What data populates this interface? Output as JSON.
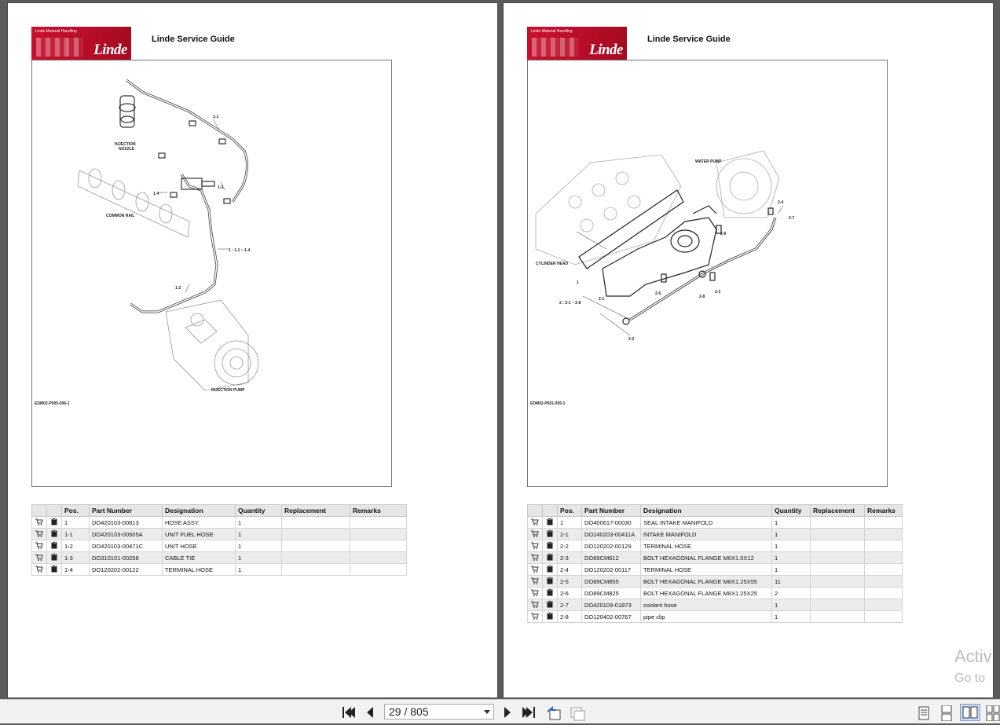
{
  "viewer": {
    "current_page": "29",
    "page_separator": "/",
    "total_pages": "805"
  },
  "watermark": {
    "line1": "Activ",
    "line2": "Go to"
  },
  "left_page": {
    "logo_small": "Linde Material Handling",
    "logo_brand": "Linde",
    "title": "Linde Service Guide",
    "drawing_code": "EDM02-P505-006-1",
    "labels": {
      "injection_nozzle_1": "INJECTION",
      "injection_nozzle_2": "NOZZLE",
      "common_rail": "COMMON RAIL",
      "injection_pump": "INJECTION PUMP",
      "c11": "1-1",
      "c12": "1-2",
      "c13": "1-3",
      "c14": "1-4",
      "range": "1 : 1-1 ~ 1-4"
    },
    "columns": [
      "Pos.",
      "Part Number",
      "Designation",
      "Quantity",
      "Replacement",
      "Remarks"
    ],
    "rows": [
      {
        "pos": "1",
        "part": "DO420103-00813",
        "designation": "HOSE ASSY.",
        "qty": "1"
      },
      {
        "pos": "1-1",
        "part": "DO420103-00505A",
        "designation": "UNIT FUEL HOSE",
        "qty": "1"
      },
      {
        "pos": "1-2",
        "part": "DO420103-00471C",
        "designation": "UNIT HOSE",
        "qty": "1"
      },
      {
        "pos": "1-3",
        "part": "DO310101-00258",
        "designation": "CABLE TIE",
        "qty": "1"
      },
      {
        "pos": "1-4",
        "part": "DO120202-00122",
        "designation": "TERMINAL HOSE",
        "qty": "1"
      }
    ]
  },
  "right_page": {
    "logo_small": "Linde Material Handling",
    "logo_brand": "Linde",
    "title": "Linde Service Guide",
    "drawing_code": "EDM02-P601-005-1",
    "labels": {
      "water_pump": "WATER PUMP",
      "cylinder_head": "CYLINDER HEAD",
      "c1": "1",
      "c21": "2-1",
      "c22": "2-2",
      "c23": "2-3",
      "c24": "2-4",
      "c25": "2-5",
      "c26": "2-6",
      "c27": "2-7",
      "c28": "2-8",
      "range": "2 : 2-1 ~ 2-8"
    },
    "columns": [
      "Pos.",
      "Part Number",
      "Designation",
      "Quantity",
      "Replacement",
      "Remarks"
    ],
    "rows": [
      {
        "pos": "1",
        "part": "DO400617-00030",
        "designation": "SEAL INTAKE MANIFOLD",
        "qty": "1"
      },
      {
        "pos": "2-1",
        "part": "DO240203-00411A",
        "designation": "INTAKE MANIFOLD",
        "qty": "1"
      },
      {
        "pos": "2-2",
        "part": "DO120202-00129",
        "designation": "TERMINAL HOSE",
        "qty": "1"
      },
      {
        "pos": "2-3",
        "part": "DO89CM612",
        "designation": "BOLT HEXAGONAL FLANGE M6X1.0X12",
        "qty": "1"
      },
      {
        "pos": "2-4",
        "part": "DO120202-00117",
        "designation": "TERMINAL HOSE",
        "qty": "1"
      },
      {
        "pos": "2-5",
        "part": "DO89CM855",
        "designation": "BOLT HEXAGONAL FLANGE M8X1.25X55",
        "qty": "11"
      },
      {
        "pos": "2-6",
        "part": "DO89CM825",
        "designation": "BOLT HEXAGONAL FLANGE M8X1.25X25",
        "qty": "2"
      },
      {
        "pos": "2-7",
        "part": "DO420109-01873",
        "designation": "coolant hose",
        "qty": "1"
      },
      {
        "pos": "2-8",
        "part": "DO120402-00767",
        "designation": "pipe clip",
        "qty": "1"
      }
    ]
  }
}
